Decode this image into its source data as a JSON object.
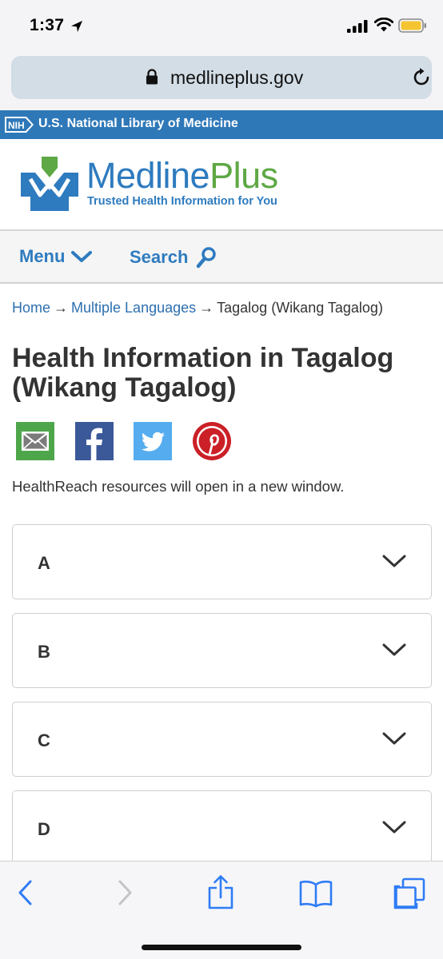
{
  "status_bar": {
    "time": "1:37",
    "icons": [
      "location-arrow-icon",
      "signal-icon",
      "wifi-icon",
      "battery-icon"
    ]
  },
  "address_bar": {
    "url": "medlineplus.gov",
    "icons": [
      "lock-icon",
      "reload-icon"
    ]
  },
  "nih_bar": {
    "badge": "NIH",
    "text": "U.S. National Library of Medicine",
    "background": "#2e78b8"
  },
  "logo": {
    "name_part1": "Medline",
    "name_part2": "Plus",
    "tagline": "Trusted Health Information for You",
    "blue": "#2e7bbf",
    "green": "#5ea845"
  },
  "nav": {
    "menu_label": "Menu",
    "search_label": "Search"
  },
  "breadcrumb": {
    "items": [
      "Home",
      "Multiple Languages",
      "Tagalog (Wikang Tagalog)"
    ],
    "separator": "→"
  },
  "page": {
    "title": "Health Information in Tagalog (Wikang Tagalog)",
    "notice": "HealthReach resources will open in a new window."
  },
  "share": {
    "icons": [
      "email-icon",
      "facebook-icon",
      "twitter-icon",
      "pinterest-icon"
    ]
  },
  "accordion": {
    "items": [
      "A",
      "B",
      "C",
      "D"
    ]
  },
  "toolbar": {
    "icons": [
      "back-icon",
      "forward-icon",
      "share-icon",
      "bookmarks-icon",
      "tabs-icon"
    ]
  }
}
